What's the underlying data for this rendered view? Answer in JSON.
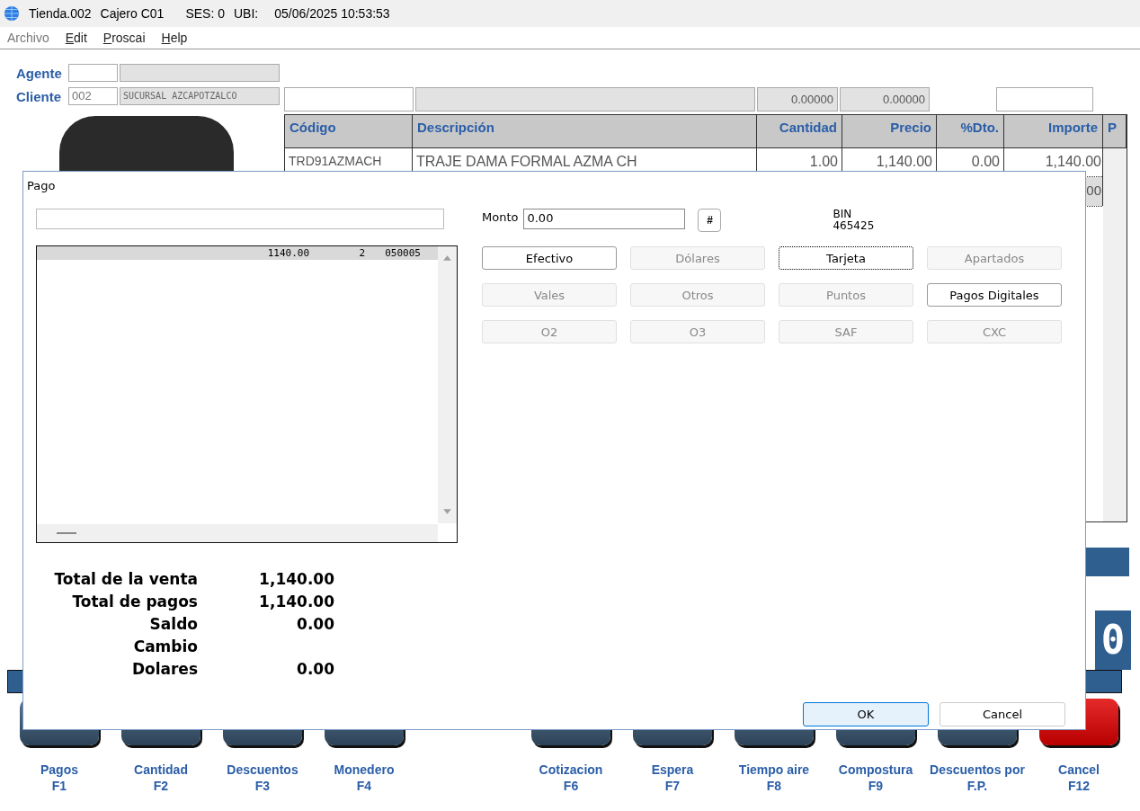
{
  "window": {
    "title_parts": [
      "Tienda.002",
      "Cajero C01",
      "SES: 0",
      "UBI:",
      "05/06/2025 10:53:53"
    ]
  },
  "menu": [
    {
      "label": "Archivo",
      "disabled": true,
      "underline": false
    },
    {
      "label": "Edit",
      "disabled": false,
      "underline": true
    },
    {
      "label": "Proscai",
      "disabled": false,
      "underline": true
    },
    {
      "label": "Help",
      "disabled": false,
      "underline": true
    }
  ],
  "agente": {
    "label": "Agente"
  },
  "cliente": {
    "label": "Cliente",
    "code": "002",
    "name": "SUCURSAL AZCAPOTZALCO"
  },
  "header_fields": {
    "field_3": "0.00000",
    "field_4": "0.00000"
  },
  "table": {
    "columns": [
      "Código",
      "Descripción",
      "Cantidad",
      "Precio",
      "%Dto.",
      "Importe",
      "P"
    ],
    "rows": [
      {
        "cells": [
          "TRD91AZMACH",
          "TRAJE DAMA FORMAL AZMA CH",
          "1.00",
          "1,140.00",
          "0.00",
          "1,140.00"
        ],
        "selected": false
      },
      {
        "cells": [
          "",
          "",
          "",
          "",
          "",
          "00"
        ],
        "selected": true
      }
    ]
  },
  "display_digit": "0",
  "function_keys_left": [
    {
      "label": "Pagos",
      "key": "F1",
      "kind": "normal"
    },
    {
      "label": "Cantidad",
      "key": "F2",
      "kind": "normal"
    },
    {
      "label": "Descuentos",
      "key": "F3",
      "kind": "normal"
    },
    {
      "label": "Monedero",
      "key": "F4",
      "kind": "normal"
    }
  ],
  "function_keys_right": [
    {
      "label": "Cotizacion",
      "key": "F6",
      "kind": "normal"
    },
    {
      "label": "Espera",
      "key": "F7",
      "kind": "normal"
    },
    {
      "label": "Tiempo aire",
      "key": "F8",
      "kind": "normal"
    },
    {
      "label": "Compostura",
      "key": "F9",
      "kind": "normal"
    },
    {
      "label": "Descuentos por",
      "key": "F.P.",
      "kind": "normal"
    },
    {
      "label": "Cancel",
      "key": "F12",
      "kind": "cancel"
    }
  ],
  "dialog": {
    "title": "Pago",
    "payments": [
      {
        "cells": [
          "1140.00",
          "2",
          "050005"
        ],
        "selected": true
      }
    ],
    "monto": {
      "label": "Monto",
      "value": "0.00"
    },
    "hash_button": "#",
    "bin_label": "BIN",
    "bin_value": "465425",
    "methods": [
      {
        "label": "Efectivo",
        "disabled": false,
        "focused": false
      },
      {
        "label": "Dólares",
        "disabled": true,
        "focused": false
      },
      {
        "label": "Tarjeta",
        "disabled": false,
        "focused": true
      },
      {
        "label": "Apartados",
        "disabled": true,
        "focused": false
      },
      {
        "label": "Vales",
        "disabled": true,
        "focused": false
      },
      {
        "label": "Otros",
        "disabled": true,
        "focused": false
      },
      {
        "label": "Puntos",
        "disabled": true,
        "focused": false
      },
      {
        "label": "Pagos Digitales",
        "disabled": false,
        "focused": false
      },
      {
        "label": "O2",
        "disabled": true,
        "focused": false
      },
      {
        "label": "O3",
        "disabled": true,
        "focused": false
      },
      {
        "label": "SAF",
        "disabled": true,
        "focused": false
      },
      {
        "label": "CXC",
        "disabled": true,
        "focused": false
      }
    ],
    "totals": [
      {
        "label": "Total de la venta",
        "value": "1,140.00"
      },
      {
        "label": "Total de pagos",
        "value": "1,140.00"
      },
      {
        "label": "Saldo",
        "value": "0.00"
      },
      {
        "label": "Cambio"
      },
      {
        "label": "Dolares",
        "value": "0.00"
      }
    ],
    "buttons": [
      {
        "label": "OK",
        "default": true
      },
      {
        "label": "Cancel",
        "default": false
      }
    ]
  }
}
